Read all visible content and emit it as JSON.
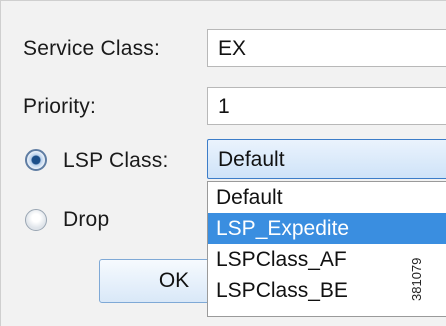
{
  "form": {
    "service_class_label": "Service Class:",
    "service_class_value": "EX",
    "priority_label": "Priority:",
    "priority_value": "1",
    "lsp_class_label": "LSP Class:",
    "lsp_class_value": "Default",
    "drop_label": "Drop",
    "selected_option": "lsp-class"
  },
  "dropdown": {
    "options": [
      "Default",
      "LSP_Expedite",
      "LSPClass_AF",
      "LSPClass_BE"
    ],
    "highlighted": "LSP_Expedite"
  },
  "buttons": {
    "ok_label": "OK"
  },
  "figure_id": "381079",
  "colors": {
    "highlight": "#3a8ee0",
    "combo_border": "#3d7dc8",
    "panel_bg": "#f2f2f2"
  }
}
